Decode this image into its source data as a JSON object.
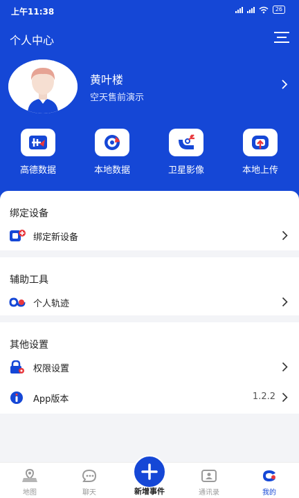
{
  "status": {
    "time": "上午11:38",
    "sig1": "5G",
    "sig2": "5G",
    "battery": "26"
  },
  "header": {
    "title": "个人中心"
  },
  "profile": {
    "name": "黄叶楼",
    "subtitle": "空天售前演示"
  },
  "quick_actions": [
    {
      "label": "高德数据",
      "icon": "amap-data-icon"
    },
    {
      "label": "本地数据",
      "icon": "local-data-icon"
    },
    {
      "label": "卫星影像",
      "icon": "satellite-image-icon"
    },
    {
      "label": "本地上传",
      "icon": "local-upload-icon"
    }
  ],
  "sections": {
    "bind": {
      "title": "绑定设备",
      "item": "绑定新设备"
    },
    "tools": {
      "title": "辅助工具",
      "item": "个人轨迹"
    },
    "other": {
      "title": "其他设置",
      "permission": "权限设置",
      "app_version_label": "App版本",
      "app_version_value": "1.2.2"
    }
  },
  "tabbar": {
    "map": "地图",
    "chat": "聊天",
    "add": "新增事件",
    "contacts": "通讯录",
    "mine": "我的"
  },
  "colors": {
    "primary": "#1547d6",
    "accent_red": "#e8383d"
  }
}
